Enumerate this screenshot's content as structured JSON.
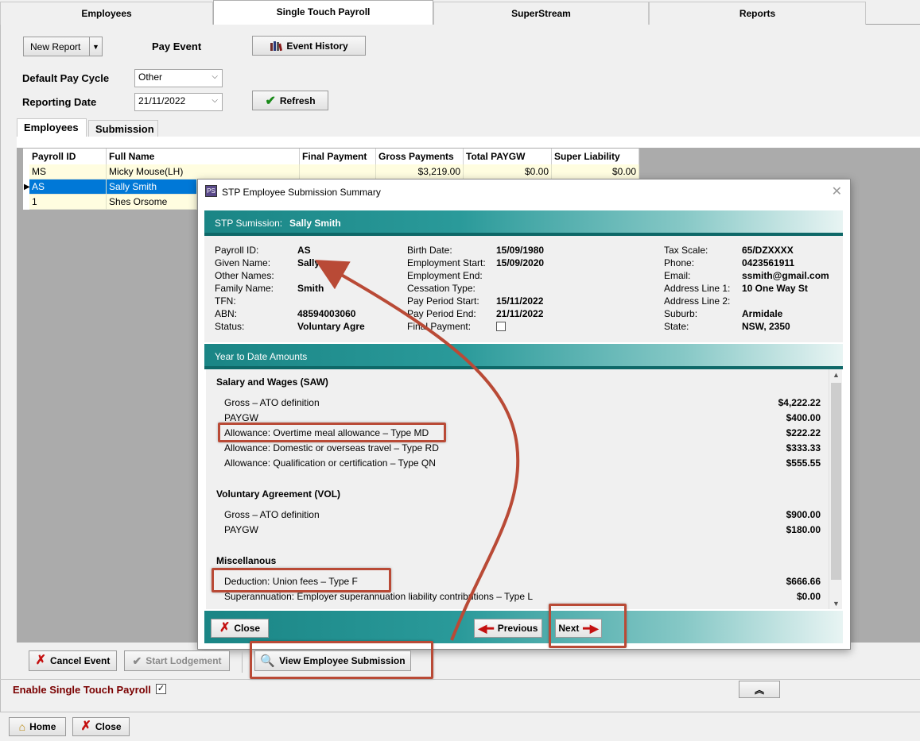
{
  "top_tabs": [
    "Employees",
    "Single Touch Payroll",
    "SuperStream",
    "Reports"
  ],
  "toolbar": {
    "new_report": "New Report",
    "pay_event": "Pay Event",
    "event_history": "Event History",
    "default_pay_cycle_label": "Default Pay Cycle",
    "default_pay_cycle_value": "Other",
    "reporting_date_label": "Reporting Date",
    "reporting_date_value": "21/11/2022",
    "refresh": "Refresh"
  },
  "sub_tabs": [
    "Employees",
    "Submission"
  ],
  "grid": {
    "headers": [
      "Payroll ID",
      "Full Name",
      "Final Payment",
      "Gross Payments",
      "Total PAYGW",
      "Super Liability"
    ],
    "rows": [
      {
        "id": "MS",
        "name": "Micky Mouse(LH)",
        "gross": "$3,219.00",
        "paygw": "$0.00",
        "super": "$0.00"
      },
      {
        "id": "AS",
        "name": "Sally Smith"
      },
      {
        "id": "1",
        "name": "Shes Orsome"
      }
    ]
  },
  "modal": {
    "title": "STP Employee Submission Summary",
    "band_label": "STP Sumission:",
    "band_name": "Sally Smith",
    "col1": [
      {
        "k": "Payroll ID:",
        "v": "AS"
      },
      {
        "k": "Given Name:",
        "v": "Sally"
      },
      {
        "k": "Other Names:",
        "v": ""
      },
      {
        "k": "Family Name:",
        "v": "Smith"
      },
      {
        "k": "TFN:",
        "v": ""
      },
      {
        "k": "ABN:",
        "v": "48594003060"
      },
      {
        "k": "Status:",
        "v": "Voluntary Agre"
      }
    ],
    "col2": [
      {
        "k": "Birth Date:",
        "v": "15/09/1980"
      },
      {
        "k": "Employment Start:",
        "v": "15/09/2020"
      },
      {
        "k": "Employment End:",
        "v": ""
      },
      {
        "k": "Cessation Type:",
        "v": ""
      },
      {
        "k": "Pay Period Start:",
        "v": "15/11/2022"
      },
      {
        "k": "Pay Period End:",
        "v": "21/11/2022"
      },
      {
        "k": "Final Payment:",
        "v": ""
      }
    ],
    "col3": [
      {
        "k": "Tax Scale:",
        "v": "65/DZXXXX"
      },
      {
        "k": "Phone:",
        "v": "0423561911"
      },
      {
        "k": "Email:",
        "v": "ssmith@gmail.com"
      },
      {
        "k": "Address Line 1:",
        "v": "10 One Way St"
      },
      {
        "k": "Address Line 2:",
        "v": ""
      },
      {
        "k": "Suburb:",
        "v": "Armidale"
      },
      {
        "k": "State:",
        "v": "NSW, 2350"
      }
    ],
    "ytd_band": "Year to Date Amounts",
    "ytd": {
      "saw_title": "Salary and Wages  (SAW)",
      "saw": [
        {
          "k": "Gross – ATO definition",
          "v": "$4,222.22"
        },
        {
          "k": "PAYGW",
          "v": "$400.00"
        },
        {
          "k": "Allowance: Overtime meal allowance  –  Type  MD",
          "v": "$222.22"
        },
        {
          "k": "Allowance: Domestic or overseas travel  –  Type  RD",
          "v": "$333.33"
        },
        {
          "k": "Allowance: Qualification or certification  –  Type  QN",
          "v": "$555.55"
        }
      ],
      "vol_title": "Voluntary Agreement  (VOL)",
      "vol": [
        {
          "k": "Gross – ATO definition",
          "v": "$900.00"
        },
        {
          "k": "PAYGW",
          "v": "$180.00"
        }
      ],
      "misc_title": "Miscellanous",
      "misc": [
        {
          "k": "Deduction: Union fees  –  Type  F",
          "v": "$666.66"
        },
        {
          "k": "Superannuation: Employer superannuation liability contributions  –  Type  L",
          "v": "$0.00"
        }
      ]
    },
    "close": "Close",
    "previous": "Previous",
    "next": "Next"
  },
  "bottom": {
    "cancel_event": "Cancel Event",
    "start_lodgement": "Start Lodgement",
    "view_employee_submission": "View Employee Submission",
    "enable_stp": "Enable Single Touch Payroll",
    "home": "Home",
    "close": "Close"
  },
  "colors": {
    "accent_teal": "#1a8585",
    "annotation": "#b94a36",
    "selection": "#0078d7",
    "enable_label": "#7a0000"
  }
}
